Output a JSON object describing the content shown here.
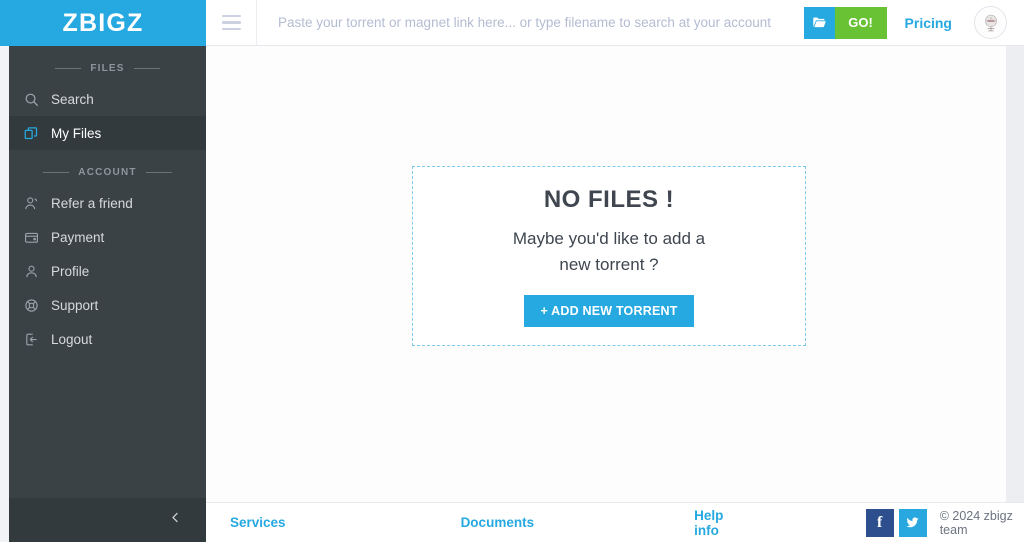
{
  "brand": {
    "logo_text": "ZBIGZ",
    "accent_color": "#26a9e0",
    "sidebar_color": "#3b4245",
    "go_green": "#68c234"
  },
  "sidebar": {
    "sections": [
      {
        "label": "FILES"
      },
      {
        "label": "ACCOUNT"
      }
    ],
    "items": [
      {
        "label": "Search",
        "icon": "search-icon",
        "active": false
      },
      {
        "label": "My Files",
        "icon": "files-icon",
        "active": true
      },
      {
        "label": "Refer a friend",
        "icon": "refer-friend-icon",
        "active": false
      },
      {
        "label": "Payment",
        "icon": "wallet-icon",
        "active": false
      },
      {
        "label": "Profile",
        "icon": "user-icon",
        "active": false
      },
      {
        "label": "Support",
        "icon": "lifebuoy-icon",
        "active": false
      },
      {
        "label": "Logout",
        "icon": "logout-icon",
        "active": false
      }
    ],
    "collapse_icon": "chevron-left-icon"
  },
  "header": {
    "menu_icon": "hamburger-icon",
    "search": {
      "placeholder": "Paste your torrent or magnet link here... or type filename to search at your account",
      "value": ""
    },
    "go_file_icon": "folder-open-icon",
    "go_label": "GO!",
    "pricing_label": "Pricing",
    "avatar_icon": "avatar-icon"
  },
  "main": {
    "empty_state": {
      "title": "NO FILES !",
      "subtitle_line1": "Maybe you'd like to add a",
      "subtitle_line2": "new torrent ?",
      "button_label": "+ ADD NEW TORRENT"
    }
  },
  "footer": {
    "links": [
      {
        "label": "Services"
      },
      {
        "label": "Documents"
      },
      {
        "label": "Help info"
      }
    ],
    "social": [
      {
        "name": "facebook",
        "glyph": "f",
        "color": "#2d4f8e"
      },
      {
        "name": "twitter",
        "glyph": "",
        "color": "#29a8e0"
      }
    ],
    "copyright": "© 2024 zbigz team"
  }
}
